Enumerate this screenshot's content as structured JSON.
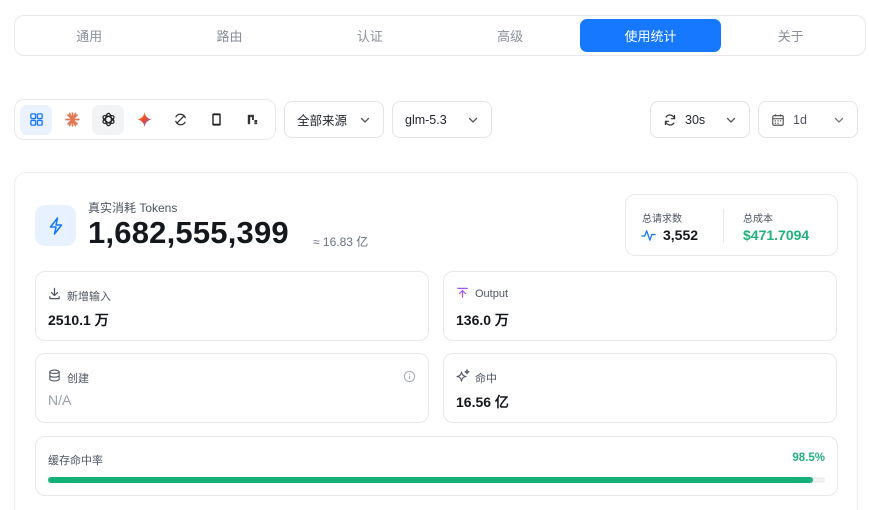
{
  "tabs": [
    {
      "label": "通用",
      "active": false
    },
    {
      "label": "路由",
      "active": false
    },
    {
      "label": "认证",
      "active": false
    },
    {
      "label": "高级",
      "active": false
    },
    {
      "label": "使用统计",
      "active": true
    },
    {
      "label": "关于",
      "active": false
    }
  ],
  "providers": [
    "grid-icon",
    "claude-icon",
    "openai-icon",
    "gemini-icon",
    "refresh-provider-icon",
    "phone-provider-icon",
    "kimi-provider-icon"
  ],
  "filters": {
    "source": "全部来源",
    "model": "glm-5.3",
    "refresh": "30s",
    "range": "1d"
  },
  "tokens": {
    "label": "真实消耗 Tokens",
    "value": "1,682,555,399",
    "approx": "≈ 16.83 亿"
  },
  "summary": {
    "requests_label": "总请求数",
    "requests_value": "3,552",
    "cost_label": "总成本",
    "cost_value": "$471.7094"
  },
  "stats": {
    "input_label": "新增输入",
    "input_value": "2510.1 万",
    "output_label": "Output",
    "output_value": "136.0 万",
    "create_label": "创建",
    "create_value": "N/A",
    "hit_label": "命中",
    "hit_value": "16.56 亿"
  },
  "cache": {
    "label": "缓存命中率",
    "percent_text": "98.5%",
    "percent": 98.5
  },
  "colors": {
    "accent": "#1677ff",
    "success": "#22b07d",
    "output_icon": "#a855f7"
  }
}
